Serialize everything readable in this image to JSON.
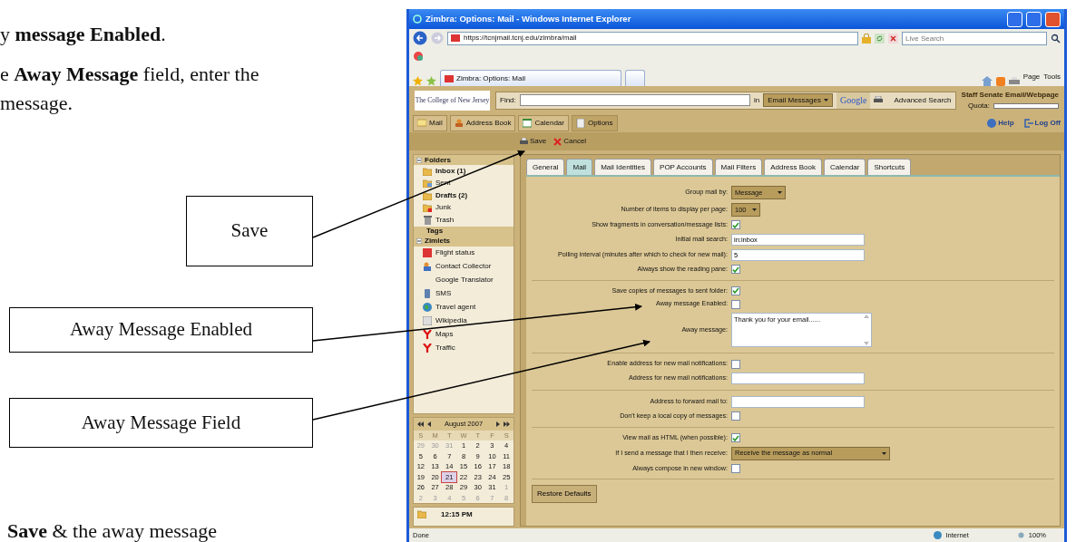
{
  "document": {
    "paragraphs": [
      {
        "lines": [
          "y **message Enabled**."
        ]
      },
      {
        "lines": [
          "e **Away Message** field, enter the",
          "message."
        ]
      }
    ],
    "footer": "**Save** & the away message"
  },
  "callouts": [
    {
      "label": "Save"
    },
    {
      "label": "Away Message Enabled"
    },
    {
      "label": "Away Message Field"
    }
  ],
  "browser": {
    "title": "Zimbra: Options: Mail - Windows Internet Explorer",
    "address": "https://tcnjmail.tcnj.edu/zimbra/mail",
    "search_placeholder": "Live Search",
    "tab": "Zimbra: Options: Mail",
    "commands": [
      "Page",
      "Tools"
    ],
    "status": "Done",
    "zone": "Internet",
    "zoom": "100%"
  },
  "app": {
    "logo": "The College of New Jersey",
    "find_label": "Find:",
    "in_label": "in",
    "search_scope": "Email Messages",
    "search_engine": "Google",
    "advanced_search": "Advanced Search",
    "account": "Staff Senate Email/Webpage",
    "quota_label": "Quota:",
    "app_tabs": [
      {
        "label": "Mail",
        "selected": false
      },
      {
        "label": "Address Book",
        "selected": false
      },
      {
        "label": "Calendar",
        "selected": false
      },
      {
        "label": "Options",
        "selected": true
      }
    ],
    "links": [
      "Help",
      "Log Off"
    ],
    "actions": [
      "Save",
      "Cancel"
    ]
  },
  "sidebar": {
    "sections": [
      {
        "title": "Folders",
        "items": [
          {
            "label": "Inbox (1)",
            "unread": true
          },
          {
            "label": "Sent",
            "unread": false
          },
          {
            "label": "Drafts (2)",
            "unread": true
          },
          {
            "label": "Junk",
            "unread": false
          },
          {
            "label": "Trash",
            "unread": false
          }
        ]
      },
      {
        "title": "Tags"
      },
      {
        "title": "Zimlets",
        "items": [
          {
            "label": "Flight status",
            "unread": false
          },
          {
            "label": "Contact Collector",
            "unread": false
          },
          {
            "label": "Google Translator",
            "unread": false
          },
          {
            "label": "SMS",
            "unread": false
          },
          {
            "label": "Travel agent",
            "unread": false
          },
          {
            "label": "Wikipedia",
            "unread": false
          },
          {
            "label": "Maps",
            "unread": false
          },
          {
            "label": "Traffic",
            "unread": false
          }
        ]
      }
    ]
  },
  "calendar": {
    "month": "August 2007",
    "weekdays": [
      "S",
      "M",
      "T",
      "W",
      "T",
      "F",
      "S"
    ],
    "weeks": [
      [
        {
          "day": "29",
          "other_month": true,
          "selected": false
        },
        {
          "day": "30",
          "other_month": true,
          "selected": false
        },
        {
          "day": "31",
          "other_month": true,
          "selected": false
        },
        {
          "day": "1",
          "other_month": false,
          "selected": false
        },
        {
          "day": "2",
          "other_month": false,
          "selected": false
        },
        {
          "day": "3",
          "other_month": false,
          "selected": false
        },
        {
          "day": "4",
          "other_month": false,
          "selected": false
        }
      ],
      [
        {
          "day": "5",
          "other_month": false,
          "selected": false
        },
        {
          "day": "6",
          "other_month": false,
          "selected": false
        },
        {
          "day": "7",
          "other_month": false,
          "selected": false
        },
        {
          "day": "8",
          "other_month": false,
          "selected": false
        },
        {
          "day": "9",
          "other_month": false,
          "selected": false
        },
        {
          "day": "10",
          "other_month": false,
          "selected": false
        },
        {
          "day": "11",
          "other_month": false,
          "selected": false
        }
      ],
      [
        {
          "day": "12",
          "other_month": false,
          "selected": false
        },
        {
          "day": "13",
          "other_month": false,
          "selected": false
        },
        {
          "day": "14",
          "other_month": false,
          "selected": false
        },
        {
          "day": "15",
          "other_month": false,
          "selected": false
        },
        {
          "day": "16",
          "other_month": false,
          "selected": false
        },
        {
          "day": "17",
          "other_month": false,
          "selected": false
        },
        {
          "day": "18",
          "other_month": false,
          "selected": false
        }
      ],
      [
        {
          "day": "19",
          "other_month": false,
          "selected": false
        },
        {
          "day": "20",
          "other_month": false,
          "selected": false
        },
        {
          "day": "21",
          "other_month": false,
          "selected": true
        },
        {
          "day": "22",
          "other_month": false,
          "selected": false
        },
        {
          "day": "23",
          "other_month": false,
          "selected": false
        },
        {
          "day": "24",
          "other_month": false,
          "selected": false
        },
        {
          "day": "25",
          "other_month": false,
          "selected": false
        }
      ],
      [
        {
          "day": "26",
          "other_month": false,
          "selected": false
        },
        {
          "day": "27",
          "other_month": false,
          "selected": false
        },
        {
          "day": "28",
          "other_month": false,
          "selected": false
        },
        {
          "day": "29",
          "other_month": false,
          "selected": false
        },
        {
          "day": "30",
          "other_month": false,
          "selected": false
        },
        {
          "day": "31",
          "other_month": false,
          "selected": false
        },
        {
          "day": "1",
          "other_month": true,
          "selected": false
        }
      ],
      [
        {
          "day": "2",
          "other_month": true,
          "selected": false
        },
        {
          "day": "3",
          "other_month": true,
          "selected": false
        },
        {
          "day": "4",
          "other_month": true,
          "selected": false
        },
        {
          "day": "5",
          "other_month": true,
          "selected": false
        },
        {
          "day": "6",
          "other_month": true,
          "selected": false
        },
        {
          "day": "7",
          "other_month": true,
          "selected": false
        },
        {
          "day": "8",
          "other_month": true,
          "selected": false
        }
      ]
    ]
  },
  "clock": "12:15 PM",
  "options": {
    "tabs": [
      {
        "label": "General",
        "selected": false
      },
      {
        "label": "Mail",
        "selected": true
      },
      {
        "label": "Mail Identities",
        "selected": false
      },
      {
        "label": "POP Accounts",
        "selected": false
      },
      {
        "label": "Mail Filters",
        "selected": false
      },
      {
        "label": "Address Book",
        "selected": false
      },
      {
        "label": "Calendar",
        "selected": false
      },
      {
        "label": "Shortcuts",
        "selected": false
      }
    ],
    "sections": [
      {
        "rows": [
          {
            "kind": "select",
            "label": "Group mail by:",
            "value": "Message"
          },
          {
            "kind": "select",
            "label": "Number of items to display per page:",
            "value": "100"
          },
          {
            "kind": "checkbox",
            "label": "Show fragments in conversation/message lists:",
            "checked": true
          },
          {
            "kind": "text",
            "label": "Initial mail search:",
            "value": "in:inbox"
          },
          {
            "kind": "text",
            "label": "Polling interval (minutes after which to check for new mail):",
            "value": "5"
          },
          {
            "kind": "checkbox",
            "label": "Always show the reading pane:",
            "checked": true
          }
        ]
      },
      {
        "rows": [
          {
            "kind": "checkbox",
            "label": "Save copies of messages to sent folder:",
            "checked": true
          },
          {
            "kind": "checkbox",
            "label": "Away message Enabled:",
            "checked": false
          },
          {
            "kind": "textarea",
            "label": "Away message:",
            "value": "Thank you for your email......"
          }
        ]
      },
      {
        "rows": [
          {
            "kind": "checkbox",
            "label": "Enable address for new mail notifications:",
            "checked": false
          },
          {
            "kind": "text",
            "label": "Address for new mail notifications:",
            "value": ""
          }
        ]
      },
      {
        "rows": [
          {
            "kind": "text",
            "label": "Address to forward mail to:",
            "value": ""
          },
          {
            "kind": "checkbox",
            "label": "Don't keep a local copy of messages:",
            "checked": false
          }
        ]
      },
      {
        "rows": [
          {
            "kind": "checkbox",
            "label": "View mail as HTML (when possible):",
            "checked": true
          },
          {
            "kind": "select",
            "label": "If I send a message that I then receive:",
            "value": "Receive the message as normal"
          },
          {
            "kind": "checkbox",
            "label": "Always compose in new window:",
            "checked": false
          }
        ]
      }
    ],
    "restore_button": "Restore Defaults"
  }
}
